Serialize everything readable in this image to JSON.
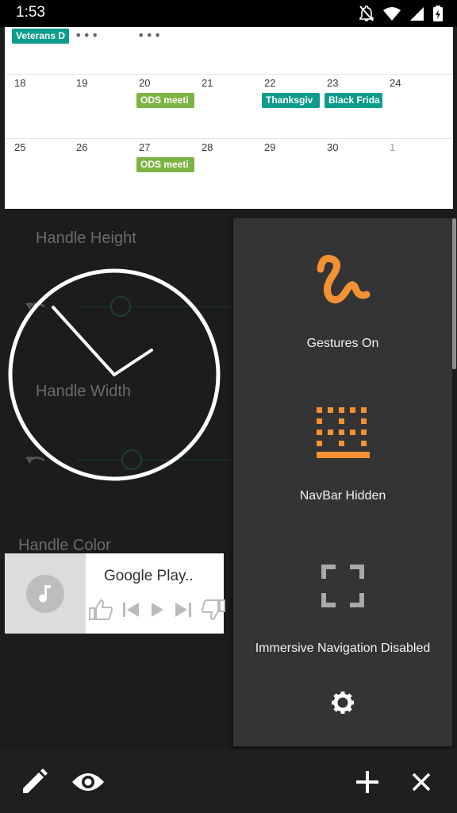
{
  "status_bar": {
    "time": "1:53",
    "icons": [
      "notifications-off-icon",
      "wifi-icon",
      "cell-signal-icon",
      "battery-charging-icon"
    ]
  },
  "calendar": {
    "top_row": {
      "events": [
        {
          "label": "Veterans D",
          "color": "#0b9c8c"
        }
      ],
      "more_indicators": [
        "•••",
        "•••"
      ]
    },
    "weeks": [
      {
        "days": [
          "18",
          "19",
          "20",
          "21",
          "22",
          "23",
          "24"
        ],
        "events": [
          {
            "day_index": 2,
            "label": "ODS meeti",
            "color": "#7cb342"
          },
          {
            "day_index": 4,
            "label": "Thanksgiv",
            "color": "#0b9c8c"
          },
          {
            "day_index": 5,
            "label": "Black Frida",
            "color": "#0b9c8c"
          }
        ]
      },
      {
        "days": [
          "25",
          "26",
          "27",
          "28",
          "29",
          "30",
          "1"
        ],
        "events": [
          {
            "day_index": 2,
            "label": "ODS meeti",
            "color": "#7cb342"
          }
        ]
      }
    ]
  },
  "settings_background": {
    "handle_height_label": "Handle Height",
    "handle_width_label": "Handle Width",
    "handle_color_label": "Handle Color"
  },
  "music_widget": {
    "title": "Google Play..",
    "controls": [
      "thumb-up-icon",
      "skip-previous-icon",
      "play-icon",
      "skip-next-icon",
      "thumb-down-icon"
    ]
  },
  "quick_panel": {
    "gestures": {
      "label": "Gestures On",
      "icon": "gesture-icon",
      "color": "#f39235"
    },
    "navbar": {
      "label": "NavBar Hidden",
      "icon": "navbar-grid-icon",
      "color": "#f39235"
    },
    "immersive": {
      "label": "Immersive Navigation Disabled",
      "icon": "fullscreen-icon",
      "color": "#a9a9a9"
    },
    "settings_icon": "gear-icon"
  },
  "bottom_bar": {
    "buttons": [
      "edit-icon",
      "eye-icon",
      "add-icon",
      "close-icon"
    ]
  }
}
